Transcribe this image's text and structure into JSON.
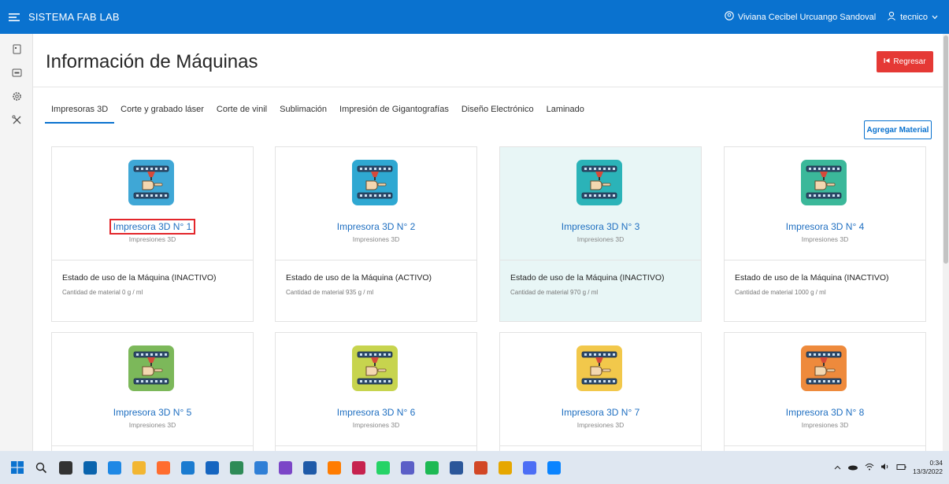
{
  "topbar": {
    "menu_icon": "menu-icon",
    "title": "SISTEMA FAB LAB",
    "user_name": "Viviana Cecibel Urcuango Sandoval",
    "role": "tecnico",
    "bg": "#0a72cf"
  },
  "rail": {
    "icons": [
      "document-icon",
      "card-icon",
      "gear-icon",
      "tools-icon"
    ]
  },
  "page": {
    "title": "Información de Máquinas",
    "back_label": "Regresar",
    "add_label": "Agregar Material"
  },
  "tabs": [
    {
      "label": "Impresoras 3D",
      "active": true
    },
    {
      "label": "Corte y grabado láser",
      "active": false
    },
    {
      "label": "Corte de vinil",
      "active": false
    },
    {
      "label": "Sublimación",
      "active": false
    },
    {
      "label": "Impresión de Gigantografías",
      "active": false
    },
    {
      "label": "Diseño Electrónico",
      "active": false
    },
    {
      "label": "Laminado",
      "active": false
    }
  ],
  "machines": [
    {
      "name": "Impresora 3D N° 1",
      "category": "Impresiones 3D",
      "state": "Estado de uso de la Máquina (INACTIVO)",
      "qty": "Cantidad de material 0 g / ml",
      "color": "#3fa7d6",
      "highlighted": false,
      "boxed": true
    },
    {
      "name": "Impresora 3D N° 2",
      "category": "Impresiones 3D",
      "state": "Estado de uso de la Máquina (ACTIVO)",
      "qty": "Cantidad de material 935 g / ml",
      "color": "#2fa8d2",
      "highlighted": false,
      "boxed": false
    },
    {
      "name": "Impresora 3D N° 3",
      "category": "Impresiones 3D",
      "state": "Estado de uso de la Máquina (INACTIVO)",
      "qty": "Cantidad de material 970 g / ml",
      "color": "#2bb3b8",
      "highlighted": true,
      "boxed": false
    },
    {
      "name": "Impresora 3D N° 4",
      "category": "Impresiones 3D",
      "state": "Estado de uso de la Máquina (INACTIVO)",
      "qty": "Cantidad de material 1000 g / ml",
      "color": "#3bb89a",
      "highlighted": false,
      "boxed": false
    },
    {
      "name": "Impresora 3D N° 5",
      "category": "Impresiones 3D",
      "color": "#7cb85a",
      "highlighted": false,
      "boxed": false
    },
    {
      "name": "Impresora 3D N° 6",
      "category": "Impresiones 3D",
      "color": "#c7d44e",
      "highlighted": false,
      "boxed": false
    },
    {
      "name": "Impresora 3D N° 7",
      "category": "Impresiones 3D",
      "color": "#f2c84b",
      "highlighted": false,
      "boxed": false
    },
    {
      "name": "Impresora 3D N° 8",
      "category": "Impresiones 3D",
      "color": "#ee8a3c",
      "highlighted": false,
      "boxed": false
    }
  ],
  "taskbar": {
    "icons": [
      "windows-start-icon",
      "search-icon",
      "task-view-icon",
      "onedrive-icon",
      "edge-icon",
      "file-explorer-icon",
      "firefox-icon",
      "app-icon",
      "app-icon",
      "app-icon",
      "vscode-icon",
      "visual-studio-icon",
      "app-icon",
      "illustrator-icon",
      "app-icon",
      "whatsapp-icon",
      "teams-icon",
      "spotify-icon",
      "word-icon",
      "app-icon",
      "app-icon",
      "app-icon",
      "app-icon"
    ],
    "time": "0:34",
    "date": "13/3/2022"
  }
}
